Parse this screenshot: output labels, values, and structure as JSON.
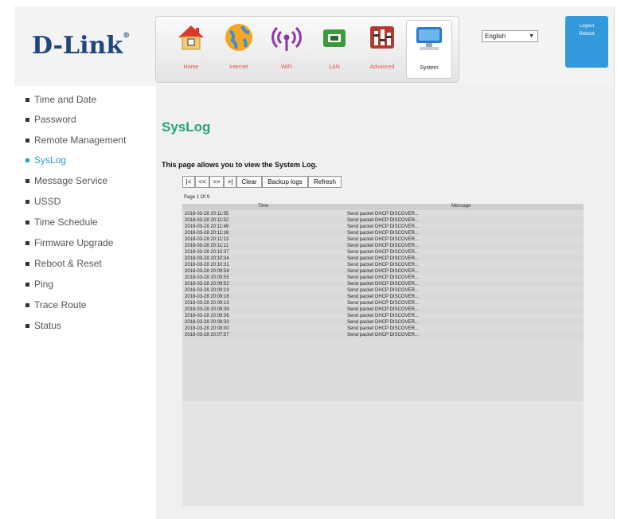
{
  "brand": {
    "logo": "D-Link",
    "mark": "®"
  },
  "nav": {
    "items": [
      {
        "label": "Home",
        "icon": "home-icon"
      },
      {
        "label": "Internet",
        "icon": "globe-icon"
      },
      {
        "label": "WiFi",
        "icon": "wifi-icon"
      },
      {
        "label": "LAN",
        "icon": "lan-icon"
      },
      {
        "label": "Advanced",
        "icon": "advanced-icon"
      },
      {
        "label": "System",
        "icon": "computer-icon"
      }
    ],
    "active": "System"
  },
  "language": {
    "selected": "English"
  },
  "account": {
    "logout_label": "Logout",
    "reboot_label": "Reboot"
  },
  "sidebar": {
    "items": [
      {
        "label": "Time and Date"
      },
      {
        "label": "Password"
      },
      {
        "label": "Remote Management"
      },
      {
        "label": "SysLog"
      },
      {
        "label": "Message Service"
      },
      {
        "label": "USSD"
      },
      {
        "label": "Time Schedule"
      },
      {
        "label": "Firmware Upgrade"
      },
      {
        "label": "Reboot & Reset"
      },
      {
        "label": "Ping"
      },
      {
        "label": "Trace Route"
      },
      {
        "label": "Status"
      }
    ],
    "active": "SysLog"
  },
  "main": {
    "title": "SysLog",
    "description": "This page allows you to view the System Log.",
    "toolbar": {
      "first": "|<",
      "prev": "<<",
      "next": ">>",
      "last": ">|",
      "clear": "Clear",
      "backup": "Backup logs",
      "refresh": "Refresh"
    },
    "page_info": "Page 1 Of 9",
    "table": {
      "columns": [
        "Time",
        "Message"
      ],
      "rows": [
        {
          "time": "2018-03-28 20:11:55",
          "message": "Send packet DHCP DISCOVER..."
        },
        {
          "time": "2018-03-28 20:11:52",
          "message": "Send packet DHCP DISCOVER..."
        },
        {
          "time": "2018-03-28 20:11:49",
          "message": "Send packet DHCP DISCOVER..."
        },
        {
          "time": "2018-03-28 20:11:16",
          "message": "Send packet DHCP DISCOVER..."
        },
        {
          "time": "2018-03-28 20:11:13",
          "message": "Send packet DHCP DISCOVER..."
        },
        {
          "time": "2018-03-28 20:11:11",
          "message": "Send packet DHCP DISCOVER..."
        },
        {
          "time": "2018-03-28 20:10:37",
          "message": "Send packet DHCP DISCOVER..."
        },
        {
          "time": "2018-03-28 20:10:34",
          "message": "Send packet DHCP DISCOVER..."
        },
        {
          "time": "2018-03-28 20:10:31",
          "message": "Send packet DHCP DISCOVER..."
        },
        {
          "time": "2018-03-28 20:09:58",
          "message": "Send packet DHCP DISCOVER..."
        },
        {
          "time": "2018-03-28 20:09:55",
          "message": "Send packet DHCP DISCOVER..."
        },
        {
          "time": "2018-03-28 20:09:52",
          "message": "Send packet DHCP DISCOVER..."
        },
        {
          "time": "2018-03-28 20:09:19",
          "message": "Send packet DHCP DISCOVER..."
        },
        {
          "time": "2018-03-28 20:09:16",
          "message": "Send packet DHCP DISCOVER..."
        },
        {
          "time": "2018-03-28 20:09:13",
          "message": "Send packet DHCP DISCOVER..."
        },
        {
          "time": "2018-03-28 20:08:39",
          "message": "Send packet DHCP DISCOVER..."
        },
        {
          "time": "2018-03-28 20:08:36",
          "message": "Send packet DHCP DISCOVER..."
        },
        {
          "time": "2018-03-28 20:08:33",
          "message": "Send packet DHCP DISCOVER..."
        },
        {
          "time": "2018-03-28 20:08:00",
          "message": "Send packet DHCP DISCOVER..."
        },
        {
          "time": "2018-03-28 20:07:57",
          "message": "Send packet DHCP DISCOVER..."
        }
      ]
    }
  },
  "colors": {
    "accent": "#3399dd",
    "title": "#27a27a",
    "brand": "#20477a"
  }
}
